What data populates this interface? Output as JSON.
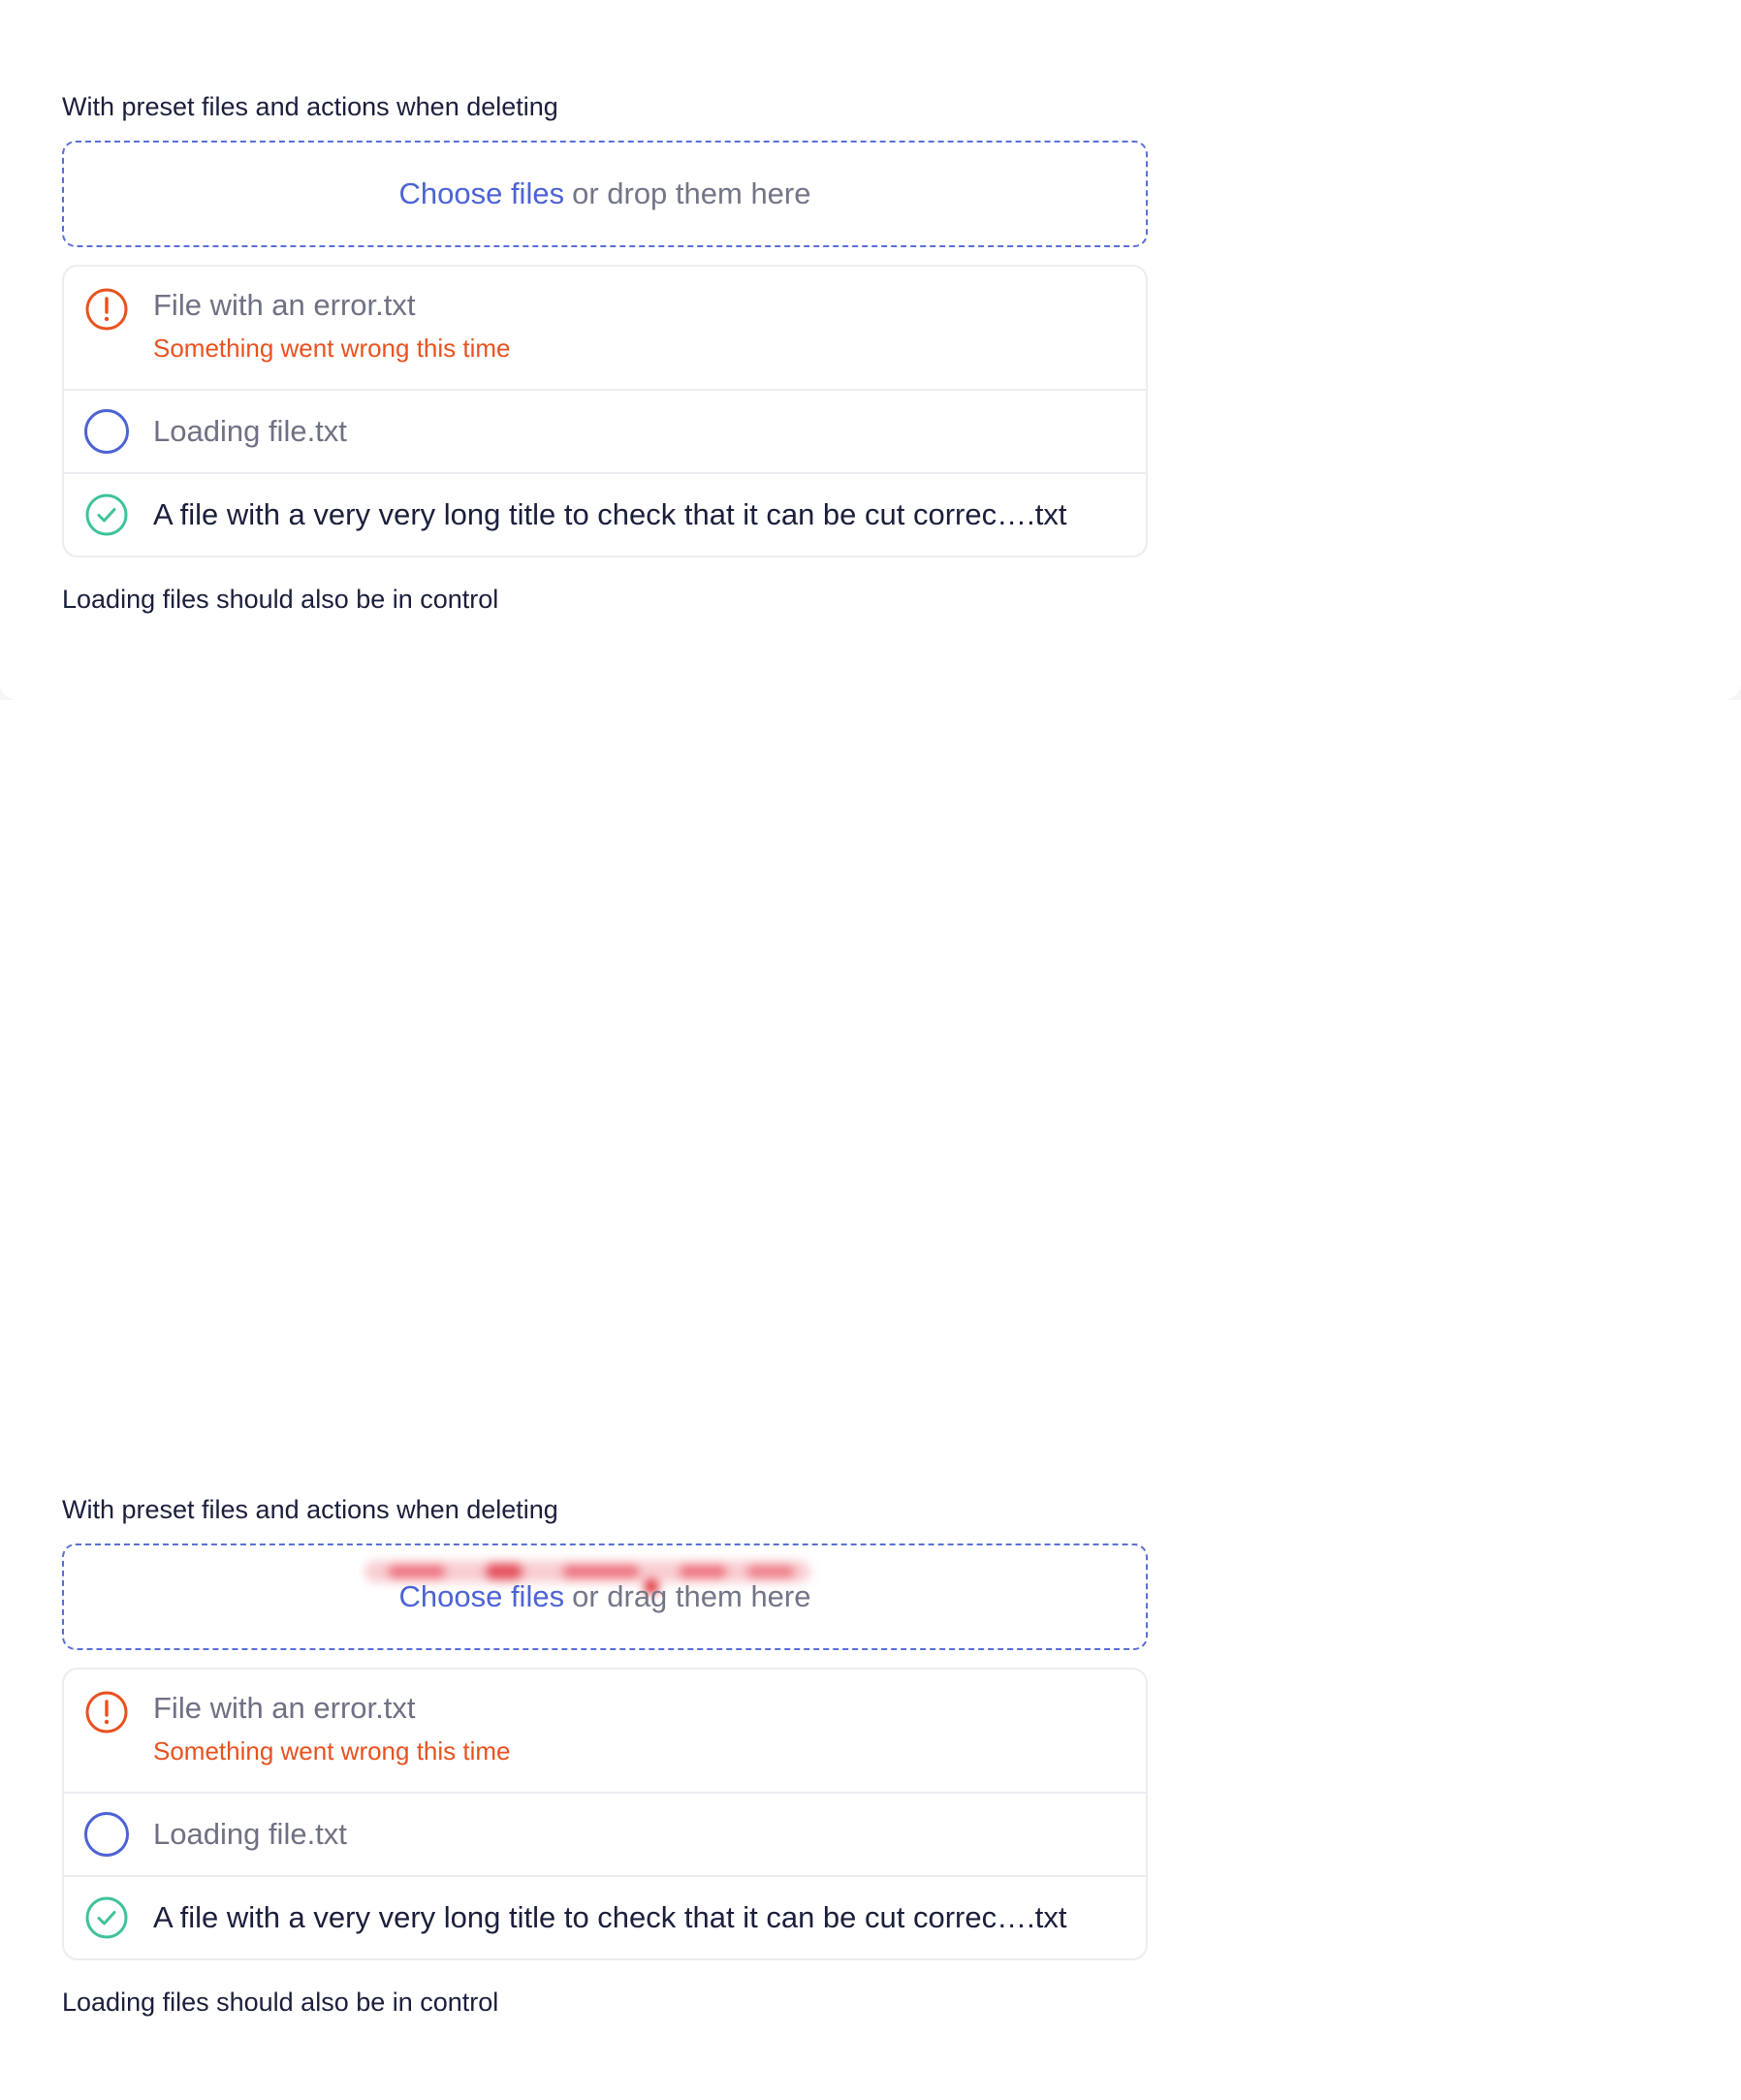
{
  "examples": [
    {
      "label": "With preset files and actions when deleting",
      "dropzone": {
        "choose": "Choose files",
        "rest": "or drop them here"
      },
      "files": [
        {
          "name": "File with an error.txt",
          "error": "Something went wrong this time"
        },
        {
          "name": "Loading file.txt"
        },
        {
          "name": "A file with a very very long title to check that it can be cut correc….txt"
        }
      ],
      "note": "Loading files should also be in control"
    },
    {
      "label": "With preset files and actions when deleting",
      "dropzone": {
        "choose": "Choose files",
        "rest": "or drag them here"
      },
      "files": [
        {
          "name": "File with an error.txt",
          "error": "Something went wrong this time"
        },
        {
          "name": "Loading file.txt"
        },
        {
          "name": "A file with a very very long title to check that it can be cut correc….txt"
        }
      ],
      "note": "Loading files should also be in control"
    }
  ],
  "colors": {
    "accent": "#4d63d4",
    "error": "#e8521f",
    "success": "#3fc29c",
    "loading": "#4d63d4"
  }
}
